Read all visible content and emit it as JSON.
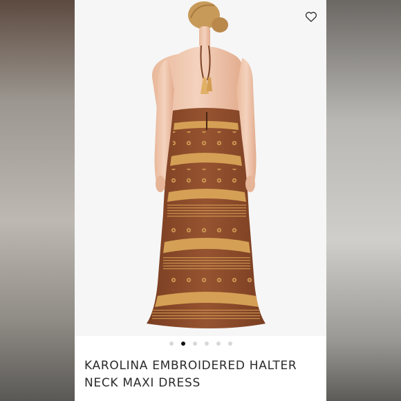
{
  "product": {
    "title_line1": "KAROLINA EMBROIDERED HALTER",
    "title_line2": "NECK MAXI DRESS",
    "image_alt": "Back view of model wearing brown embroidered halter neck maxi dress"
  },
  "carousel": {
    "total": 6,
    "active_index": 1
  },
  "icons": {
    "wishlist": "heart-outline-icon"
  },
  "colors": {
    "dress_brown": "#8a4a2a",
    "embroidery_gold": "#d9a558",
    "background": "#f6f6f6"
  }
}
